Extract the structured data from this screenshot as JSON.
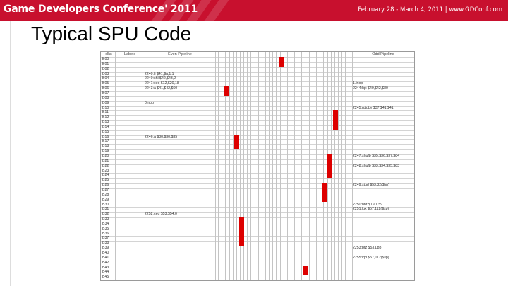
{
  "banner": {
    "title": "Game Developers Conference' 2011",
    "info": "February 28 - March 4, 2011 | www.GDConf.com"
  },
  "slide": {
    "title": "Typical SPU Code"
  },
  "table": {
    "headers": {
      "cycle": "clks",
      "labels": "Labels",
      "even": "Even Pipeline",
      "odd": "Odd Pipeline"
    },
    "row_labels": [
      "B00",
      "B01",
      "B02",
      "B03",
      "B04",
      "B05",
      "B06",
      "B07",
      "B08",
      "B09",
      "B10",
      "B11",
      "B12",
      "B13",
      "B14",
      "B15",
      "B16",
      "B17",
      "B18",
      "B19",
      "B20",
      "B21",
      "B22",
      "B23",
      "B24",
      "B25",
      "B26",
      "B27",
      "B28",
      "B29",
      "B30",
      "B31",
      "B32",
      "B33",
      "B34",
      "B35",
      "B36",
      "B37",
      "B38",
      "B39",
      "B40",
      "B41",
      "B42",
      "B43",
      "B44",
      "B45"
    ],
    "even_entries": [
      {
        "row": 3,
        "text": "2240:fi $41,$a,1.1"
      },
      {
        "row": 4,
        "text": "2240:shl $42,$43,2"
      },
      {
        "row": 5,
        "text": "2241:ceq $12,$20,18"
      },
      {
        "row": 6,
        "text": "2243:a $41,$42,$60"
      },
      {
        "row": 9,
        "text": "0.nop"
      },
      {
        "row": 16,
        "text": "2246:a $30,$30,$35"
      },
      {
        "row": 32,
        "text": "2252:ceq $53,$54,0"
      }
    ],
    "odd_entries": [
      {
        "row": 5,
        "text": "1.lnop"
      },
      {
        "row": 6,
        "text": "2244:lqx $40,$42,$80"
      },
      {
        "row": 10,
        "text": "2245:rotqby $37,$41,$41"
      },
      {
        "row": 20,
        "text": "2247:shufb $35,$36,$37,$84"
      },
      {
        "row": 22,
        "text": "2248:shufb $33,$34,$35,$83"
      },
      {
        "row": 26,
        "text": "2249:stqd $53,32($sp)"
      },
      {
        "row": 30,
        "text": "2250:hbr $19,1.59"
      },
      {
        "row": 31,
        "text": "2251:lqx $57,112($sp)"
      },
      {
        "row": 39,
        "text": "2253:brz $53,L8b"
      },
      {
        "row": 41,
        "text": "2255:lqd $57,112($sp)"
      }
    ]
  }
}
